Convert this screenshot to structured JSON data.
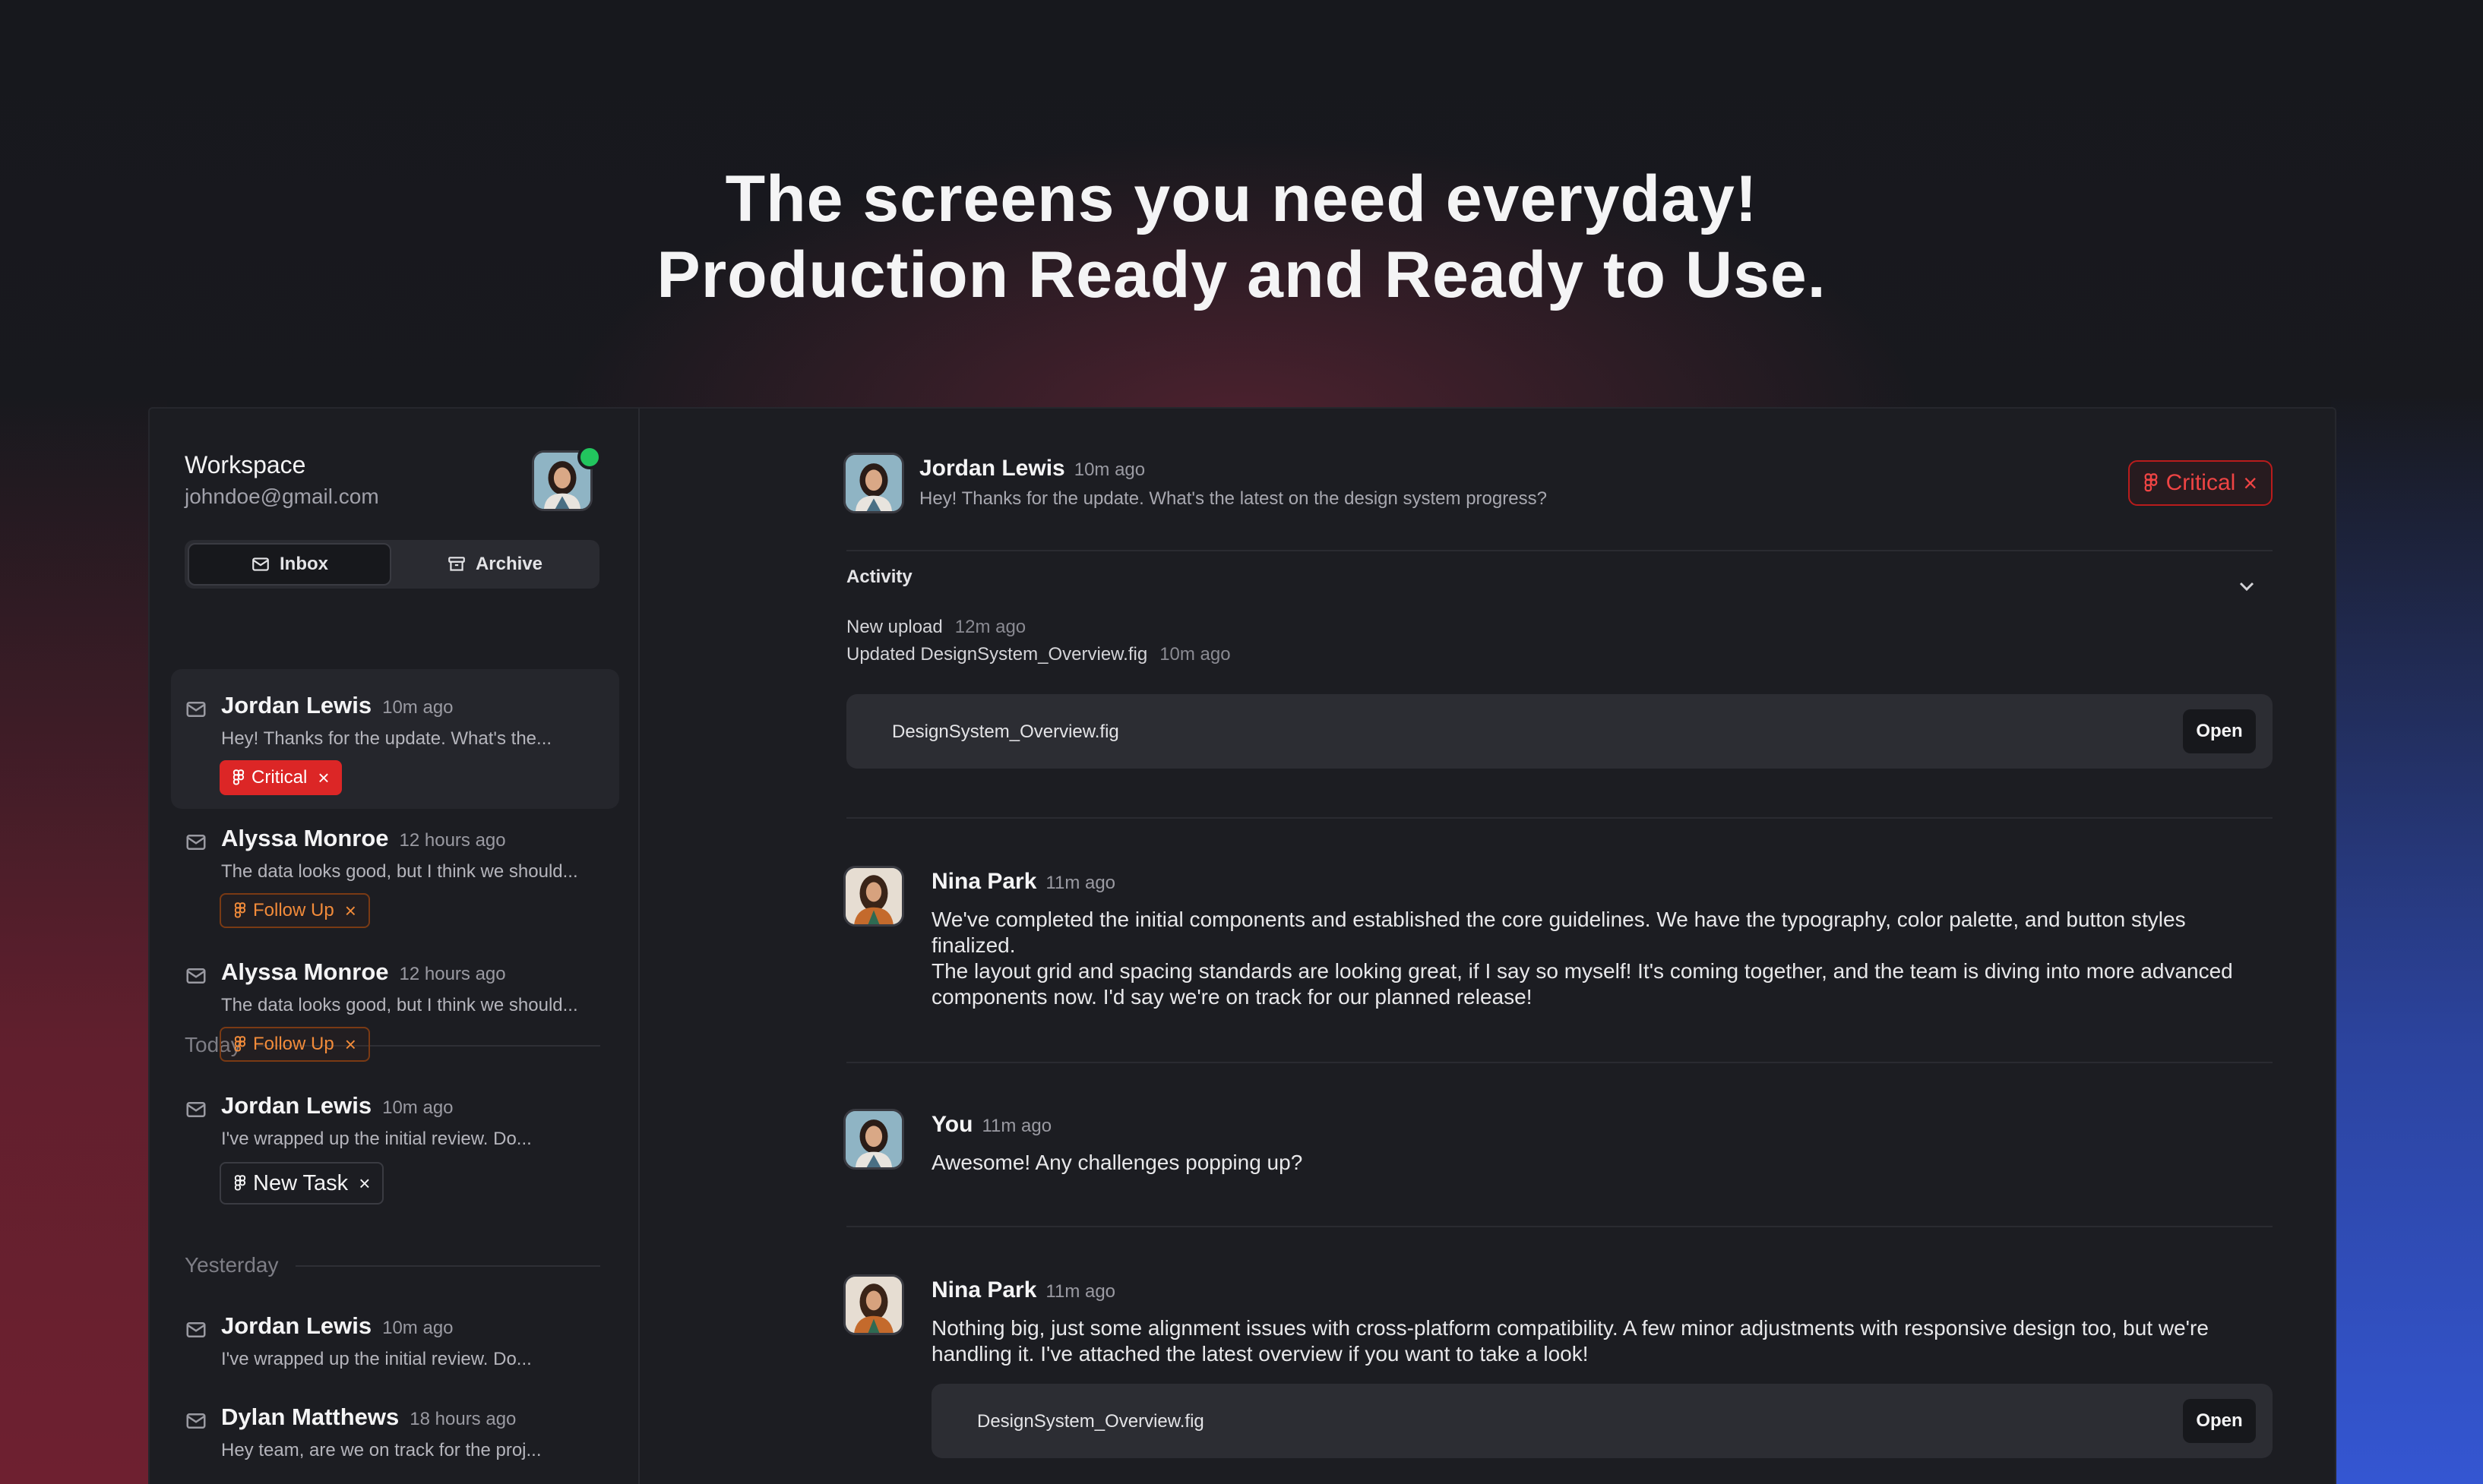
{
  "hero": {
    "line1": "The screens you need everyday!",
    "line2": "Production Ready and Ready to Use."
  },
  "sidebar": {
    "workspace_title": "Workspace",
    "email": "johndoe@gmail.com",
    "tabs": {
      "inbox": "Inbox",
      "archive": "Archive"
    },
    "section_today": "Today",
    "section_yesterday": "Yesterday",
    "today": [
      {
        "sender": "Jordan Lewis",
        "time": "10m ago",
        "preview": "Hey! Thanks for the update. What's the...",
        "tag": "Critical"
      },
      {
        "sender": "Alyssa Monroe",
        "time": "12 hours ago",
        "preview": "The data looks good, but I think we  should...",
        "tag": "Follow Up"
      },
      {
        "sender": "Alyssa Monroe",
        "time": "12 hours ago",
        "preview": "The data looks good, but I think we  should...",
        "tag": "Follow Up"
      },
      {
        "sender": "Jordan Lewis",
        "time": "10m ago",
        "preview": "I've wrapped up the initial review. Do...",
        "tag": "New Task"
      }
    ],
    "yesterday": [
      {
        "sender": "Jordan Lewis",
        "time": "10m ago",
        "preview": "I've wrapped up the initial review. Do..."
      },
      {
        "sender": "Dylan Matthews",
        "time": "18 hours ago",
        "preview": "Hey team, are we on track for the proj..."
      }
    ]
  },
  "thread": {
    "sender": "Jordan Lewis",
    "time": "10m ago",
    "preview": "Hey! Thanks for the update. What's the latest on the design system progress?",
    "tag": "Critical",
    "activity": {
      "title": "Activity",
      "items": [
        {
          "text": "New upload",
          "time": "12m ago"
        },
        {
          "text": "Updated DesignSystem_Overview.fig",
          "time": "10m ago"
        }
      ],
      "file": {
        "name": "DesignSystem_Overview.fig",
        "open_label": "Open"
      }
    },
    "messages": [
      {
        "sender": "Nina Park",
        "time": "11m ago",
        "para1": "We've completed the initial components and established the core guidelines. We have the typography, color palette, and button styles finalized.",
        "para2": "The layout grid and spacing standards are looking great, if I say so myself! It's coming together, and the team is diving into more advanced components now. I'd say we're on track for our planned release!"
      },
      {
        "sender": "You",
        "time": "11m ago",
        "para1": "Awesome! Any challenges popping up?"
      },
      {
        "sender": "Nina Park",
        "time": "11m ago",
        "para1": "Nothing big, just some alignment issues with cross-platform compatibility. A few minor adjustments with responsive design too, but we're handling it. I've attached the latest overview if you want to take a look!",
        "file": {
          "name": "DesignSystem_Overview.fig",
          "open_label": "Open"
        }
      }
    ]
  },
  "colors": {
    "critical": "#dc2626",
    "follow_up": "#f28b3a",
    "online": "#22c55e",
    "panel": "#1c1d22"
  },
  "icons": [
    "mail-icon",
    "inbox-icon",
    "archive-icon",
    "figma-icon",
    "close-icon",
    "chevron-down-icon"
  ]
}
